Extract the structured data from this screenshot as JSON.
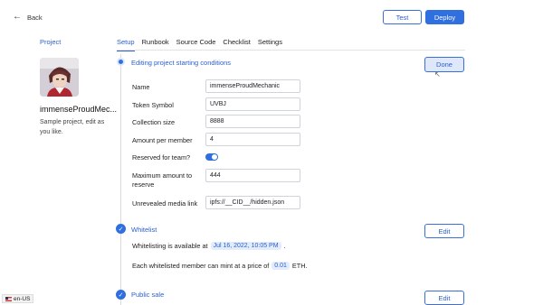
{
  "header": {
    "back_label": "Back",
    "test_label": "Test",
    "deploy_label": "Deploy"
  },
  "sidebar": {
    "section_label": "Project",
    "project_name": "immenseProudMec...",
    "project_description": "Sample project, edit as you like."
  },
  "tabs": [
    {
      "label": "Setup",
      "active": true
    },
    {
      "label": "Runbook",
      "active": false
    },
    {
      "label": "Source Code",
      "active": false
    },
    {
      "label": "Checklist",
      "active": false
    },
    {
      "label": "Settings",
      "active": false
    }
  ],
  "conditions": {
    "title": "Editing project starting conditions",
    "done_label": "Done",
    "fields": [
      {
        "label": "Name",
        "value": "immenseProudMechanic"
      },
      {
        "label": "Token Symbol",
        "value": "UVBJ"
      },
      {
        "label": "Collection size",
        "value": "8888"
      },
      {
        "label": "Amount per member",
        "value": "4"
      },
      {
        "label": "Reserved for team?",
        "toggle": true
      },
      {
        "label": "Maximum amount to reserve",
        "value": "444"
      },
      {
        "label": "Unrevealed media link",
        "value": "ipfs://__CID__/hidden.json"
      }
    ]
  },
  "whitelist": {
    "title": "Whitelist",
    "edit_label": "Edit",
    "line1_prefix": "Whitelisting is available at",
    "line1_date": "Jul 16, 2022, 10:05 PM",
    "line1_suffix": ".",
    "line2_prefix": "Each whitelisted member can mint at a price of",
    "line2_price": "0.01",
    "line2_suffix": "ETH."
  },
  "public_sale": {
    "title": "Public sale",
    "edit_label": "Edit"
  },
  "locale": {
    "label": "en-US"
  },
  "colors": {
    "accent": "#2f6fe0",
    "accent_light": "#dfe8fb"
  }
}
